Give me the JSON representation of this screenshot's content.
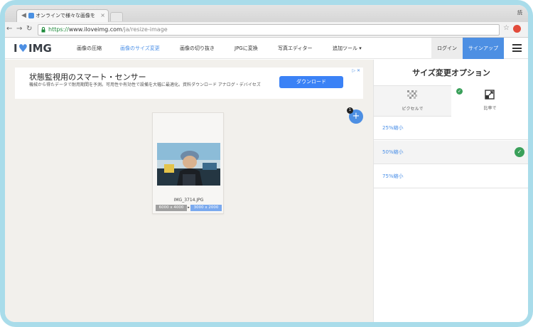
{
  "browser": {
    "tab_title": "オンラインで様々な画像を",
    "window_user": "読",
    "url_scheme": "https://",
    "url_host": "www.iloveimg.com",
    "url_path": "/ja/resize-image"
  },
  "header": {
    "logo_left": "I",
    "logo_heart": "♥",
    "logo_right": "IMG",
    "nav": [
      {
        "label": "画像の圧縮"
      },
      {
        "label": "画像のサイズ変更"
      },
      {
        "label": "画像の切り抜き"
      },
      {
        "label": "JPGに変換"
      },
      {
        "label": "写真エディター"
      },
      {
        "label": "追加ツール ▾"
      }
    ],
    "login_label": "ログイン",
    "signup_label": "サインアップ"
  },
  "ad": {
    "title": "状態監視用のスマート・センサー",
    "description": "機械から得たデータで耐用期間を予測。可用性や有効性で設備を大幅に最適化。資料ダウンロード アナログ・デバイセズ",
    "button_label": "ダウンロード",
    "choice_label": "▷ ✕"
  },
  "workspace": {
    "files_count": "1",
    "add_label": "+",
    "file": {
      "name": "IMG_3714.JPG",
      "size_original": "6000 x 4000",
      "size_new": "3000 x 2000"
    }
  },
  "sidebar": {
    "title": "サイズ変更オプション",
    "modes": [
      {
        "label": "ピクセルで"
      },
      {
        "label": "比率で"
      }
    ],
    "options": [
      {
        "label": "25%縮小"
      },
      {
        "label": "50%縮小"
      },
      {
        "label": "75%縮小"
      }
    ],
    "check_glyph": "✓"
  },
  "colors": {
    "accent": "#4d8fe3",
    "check": "#3aa05a",
    "frame": "#a9dcea"
  },
  "selected_option_index": 1,
  "selected_mode_index": 1
}
